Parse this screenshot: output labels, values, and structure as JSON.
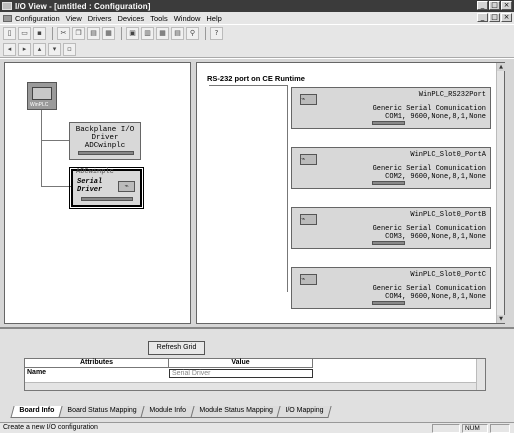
{
  "window": {
    "title": "I/O View - [untitled : Configuration]",
    "controls": [
      "_",
      "□",
      "×"
    ]
  },
  "menu": [
    {
      "label": "Configuration",
      "key": "C"
    },
    {
      "label": "View",
      "key": "V"
    },
    {
      "label": "Drivers",
      "key": "D"
    },
    {
      "label": "Devices",
      "key": "e"
    },
    {
      "label": "Tools",
      "key": "T"
    },
    {
      "label": "Window",
      "key": "W"
    },
    {
      "label": "Help",
      "key": "H"
    }
  ],
  "mdi_controls": [
    "_",
    "□",
    "×"
  ],
  "tree": {
    "pc_label": "WinPLC",
    "backplane": {
      "line1": "Backplane I/O",
      "line2": "Driver",
      "line3": "ADCwinplc"
    },
    "serial": {
      "overlay": "ADCwinplc",
      "line1": "Serial",
      "line2": "Driver"
    }
  },
  "detail": {
    "header": "RS-232 port on CE Runtime",
    "ports": [
      {
        "name": "WinPLC_RS232Port",
        "desc": "Generic Serial Comunication",
        "settings": "COM1, 9600,None,8,1,None"
      },
      {
        "name": "WinPLC_Slot0_PortA",
        "desc": "Generic Serial Comunication",
        "settings": "COM2, 9600,None,8,1,None"
      },
      {
        "name": "WinPLC_Slot0_PortB",
        "desc": "Generic Serial Comunication",
        "settings": "COM3, 9600,None,8,1,None"
      },
      {
        "name": "WinPLC_Slot0_PortC",
        "desc": "Generic Serial Comunication",
        "settings": "COM4, 9600,None,8,1,None"
      }
    ]
  },
  "grid": {
    "refresh_label": "Refresh Grid",
    "col_attributes": "Attributes",
    "col_value": "Value",
    "row_name": "Name",
    "row_value": "Serial Driver"
  },
  "tabs": [
    "Board Info",
    "Board Status Mapping",
    "Module Info",
    "Module Status Mapping",
    "I/O Mapping"
  ],
  "status": {
    "message": "Create a new I/O configuration",
    "num": "NUM"
  }
}
